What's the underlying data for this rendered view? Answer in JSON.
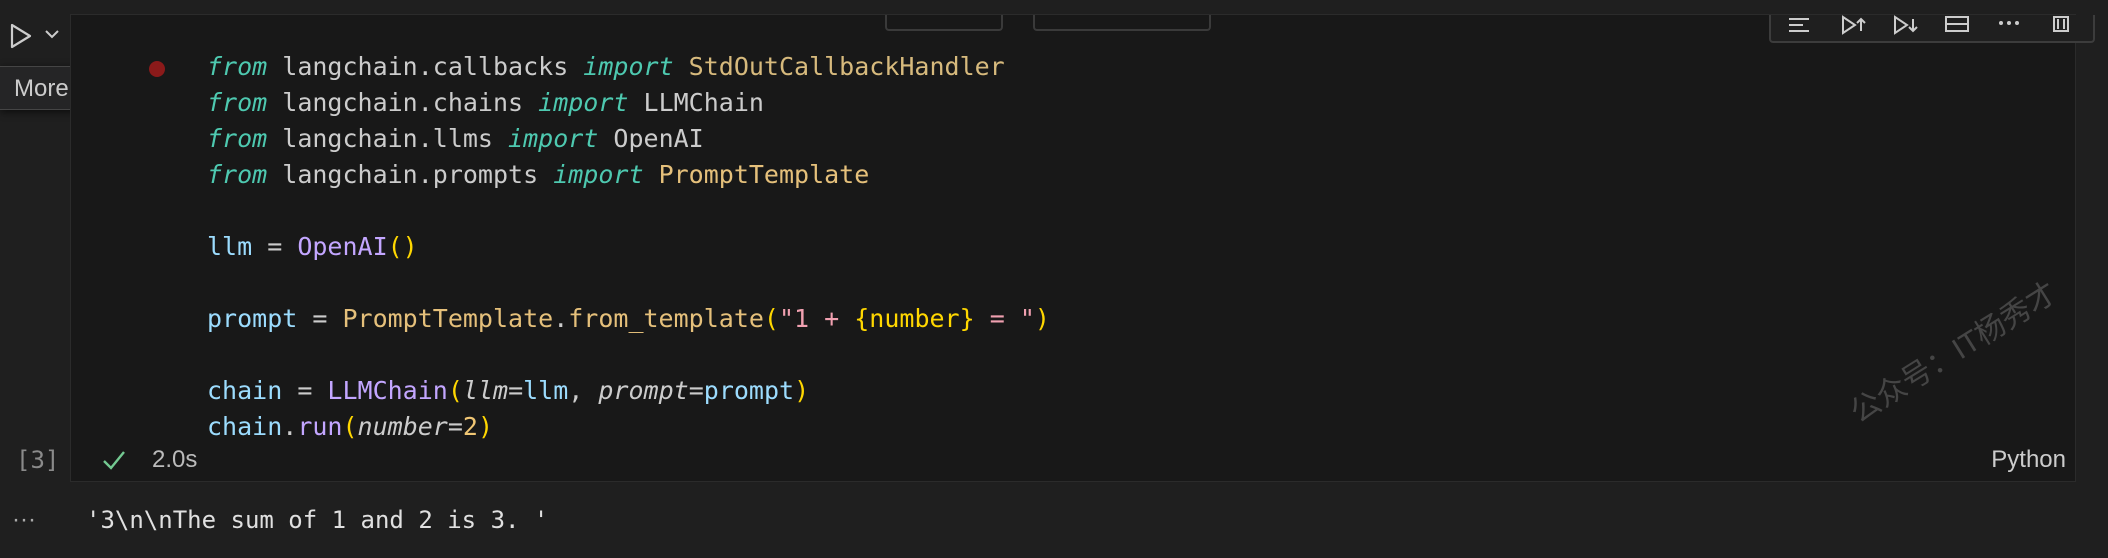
{
  "toolbar": {
    "run_icon": "play-icon",
    "run_dropdown_icon": "chevron-down-icon",
    "tooltip": "More..."
  },
  "cell_toolbar": {
    "icons": [
      "run-above-icon",
      "run-cell-and-above-icon",
      "run-cell-and-below-icon",
      "split-cell-icon",
      "more-actions-icon",
      "delete-icon"
    ]
  },
  "code": {
    "line1": {
      "kw1": "from",
      "mod": " langchain.callbacks ",
      "kw2": "import",
      "name": " StdOutCallbackHandler"
    },
    "line2": {
      "kw1": "from",
      "mod": " langchain.chains ",
      "kw2": "import",
      "name": " LLMChain"
    },
    "line3": {
      "kw1": "from",
      "mod": " langchain.llms ",
      "kw2": "import",
      "name": " OpenAI"
    },
    "line4": {
      "kw1": "from",
      "mod": " langchain.prompts ",
      "kw2": "import",
      "name": " PromptTemplate"
    },
    "line6": {
      "var": "llm",
      "eq": " = ",
      "cls": "OpenAI",
      "p": "()"
    },
    "line8": {
      "var": "prompt",
      "eq": " = ",
      "cls": "PromptTemplate",
      "dot": ".",
      "fn": "from_template",
      "po": "(",
      "str1": "\"1 + ",
      "brace": "{number}",
      "str2": " = \"",
      "pc": ")"
    },
    "line10": {
      "var": "chain",
      "eq": " = ",
      "cls": "LLMChain",
      "po": "(",
      "p1": "llm",
      "e1": "=",
      "v1": "llm",
      "c1": ", ",
      "p2": "prompt",
      "e2": "=",
      "v2": "prompt",
      "pc": ")"
    },
    "line11": {
      "var": "chain",
      "dot": ".",
      "fn": "run",
      "po": "(",
      "p1": "number",
      "e1": "=",
      "n1": "2",
      "pc": ")"
    }
  },
  "status": {
    "exec_count": "[3]",
    "check_icon": "check-icon",
    "duration": "2.0s",
    "language": "Python"
  },
  "output": {
    "more": "···",
    "text": "'3\\n\\nThe sum of 1 and 2 is 3. '"
  },
  "watermark": "公众号：IT杨秀才",
  "colors": {
    "background": "#1f1f1f",
    "cell_background": "#181818",
    "keyword": "#4ec9b0",
    "variable": "#9cdcfe",
    "function": "#dcdcaa",
    "string": "#ce9178",
    "breakpoint": "#8b1a1a"
  }
}
